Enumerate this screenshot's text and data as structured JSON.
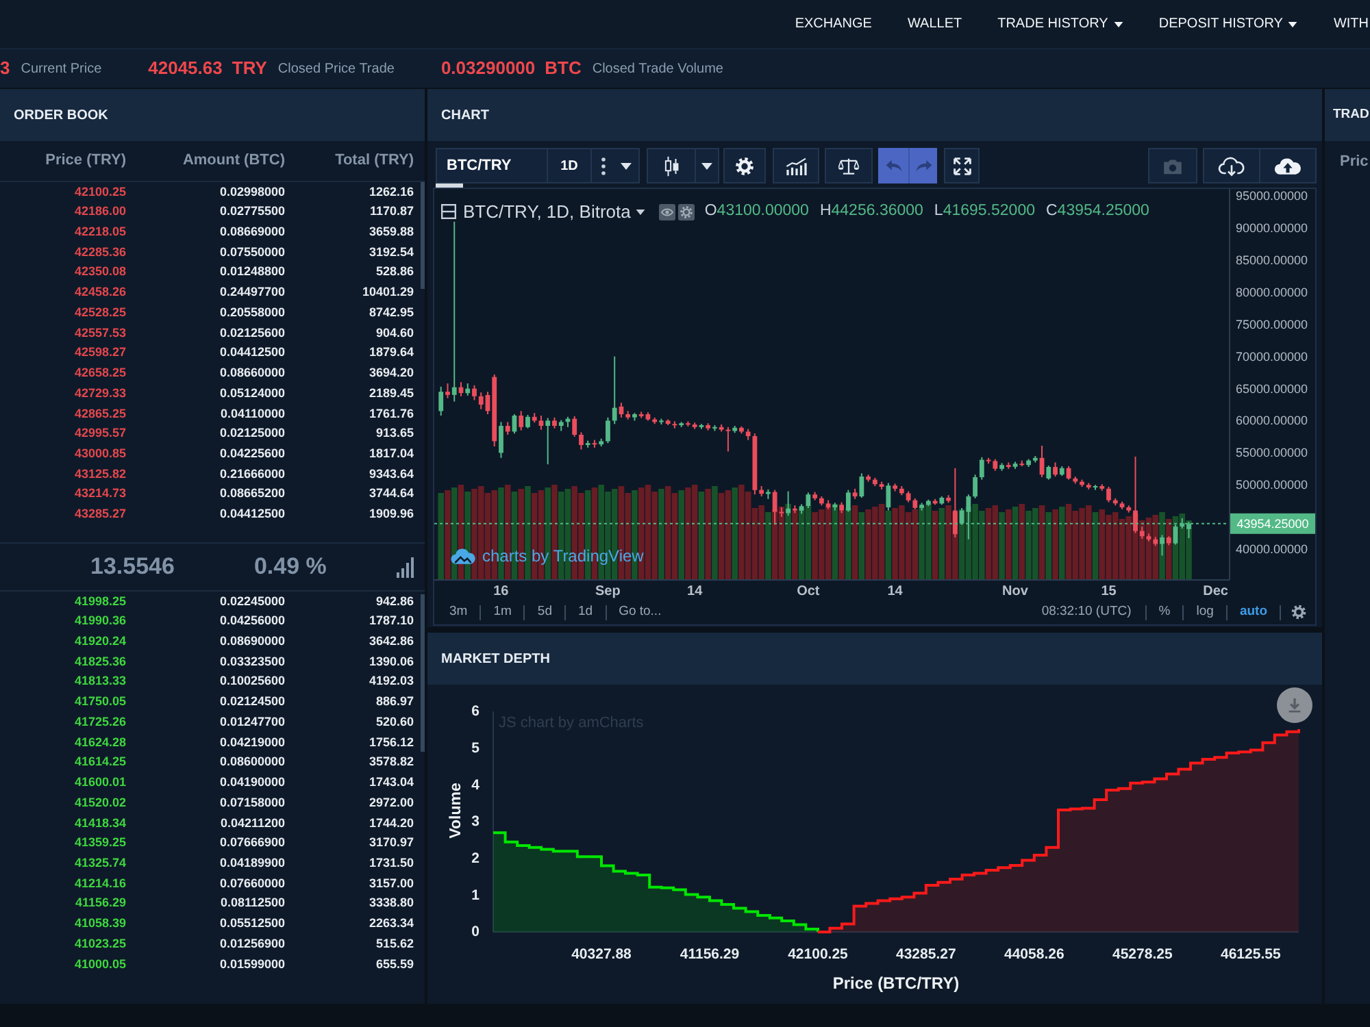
{
  "nav": {
    "items": [
      {
        "label": "EXCHANGE",
        "dropdown": false
      },
      {
        "label": "WALLET",
        "dropdown": false
      },
      {
        "label": "TRADE HISTORY",
        "dropdown": true
      },
      {
        "label": "DEPOSIT HISTORY",
        "dropdown": true
      },
      {
        "label": "WITH",
        "dropdown": false
      }
    ]
  },
  "ticker": [
    {
      "kind": "value",
      "text": "3"
    },
    {
      "kind": "label",
      "text": "Current Price"
    },
    {
      "kind": "value",
      "text": "42045.63"
    },
    {
      "kind": "unit",
      "text": "TRY"
    },
    {
      "kind": "label",
      "text": "Closed Price Trade"
    },
    {
      "kind": "value",
      "text": "0.03290000"
    },
    {
      "kind": "unit",
      "text": "BTC"
    },
    {
      "kind": "label",
      "text": "Closed Trade Volume"
    }
  ],
  "order_book": {
    "title": "ORDER BOOK",
    "columns": [
      "Price (TRY)",
      "Amount (BTC)",
      "Total (TRY)"
    ],
    "asks": [
      [
        "42100.25",
        "0.02998000",
        "1262.16"
      ],
      [
        "42186.00",
        "0.02775500",
        "1170.87"
      ],
      [
        "42218.05",
        "0.08669000",
        "3659.88"
      ],
      [
        "42285.36",
        "0.07550000",
        "3192.54"
      ],
      [
        "42350.08",
        "0.01248800",
        "528.86"
      ],
      [
        "42458.26",
        "0.24497700",
        "10401.29"
      ],
      [
        "42528.25",
        "0.20558000",
        "8742.95"
      ],
      [
        "42557.53",
        "0.02125600",
        "904.60"
      ],
      [
        "42598.27",
        "0.04412500",
        "1879.64"
      ],
      [
        "42658.25",
        "0.08660000",
        "3694.20"
      ],
      [
        "42729.33",
        "0.05124000",
        "2189.45"
      ],
      [
        "42865.25",
        "0.04110000",
        "1761.76"
      ],
      [
        "42995.57",
        "0.02125000",
        "913.65"
      ],
      [
        "43000.85",
        "0.04225600",
        "1817.04"
      ],
      [
        "43125.82",
        "0.21666000",
        "9343.64"
      ],
      [
        "43214.73",
        "0.08665200",
        "3744.64"
      ],
      [
        "43285.27",
        "0.04412500",
        "1909.96"
      ]
    ],
    "spread": {
      "value": "13.5546",
      "percent": "0.49 %"
    },
    "bids": [
      [
        "41998.25",
        "0.02245000",
        "942.86"
      ],
      [
        "41990.36",
        "0.04256000",
        "1787.10"
      ],
      [
        "41920.24",
        "0.08690000",
        "3642.86"
      ],
      [
        "41825.36",
        "0.03323500",
        "1390.06"
      ],
      [
        "41813.33",
        "0.10025600",
        "4192.03"
      ],
      [
        "41750.05",
        "0.02124500",
        "886.97"
      ],
      [
        "41725.26",
        "0.01247700",
        "520.60"
      ],
      [
        "41624.28",
        "0.04219000",
        "1756.12"
      ],
      [
        "41614.25",
        "0.08600000",
        "3578.82"
      ],
      [
        "41600.01",
        "0.04190000",
        "1743.04"
      ],
      [
        "41520.02",
        "0.07158000",
        "2972.00"
      ],
      [
        "41418.34",
        "0.04211200",
        "1744.20"
      ],
      [
        "41359.25",
        "0.07666900",
        "3170.97"
      ],
      [
        "41325.74",
        "0.04189900",
        "1731.50"
      ],
      [
        "41214.16",
        "0.07660000",
        "3157.00"
      ],
      [
        "41156.29",
        "0.08112500",
        "3338.80"
      ],
      [
        "41058.39",
        "0.05512500",
        "2263.34"
      ],
      [
        "41023.25",
        "0.01256900",
        "515.62"
      ],
      [
        "41000.05",
        "0.01599000",
        "655.59"
      ]
    ]
  },
  "chart": {
    "title": "CHART",
    "toolbar": {
      "symbol": "BTC/TRY",
      "interval": "1D"
    },
    "legend": {
      "title": "BTC/TRY, 1D, Bitrota",
      "values": [
        {
          "label": "O",
          "value": "43100.00000"
        },
        {
          "label": "H",
          "value": "44256.36000"
        },
        {
          "label": "L",
          "value": "41695.52000"
        },
        {
          "label": "C",
          "value": "43954.25000"
        }
      ]
    },
    "chart_data": {
      "type": "candlestick",
      "x": [
        "--08-07",
        "--08-08",
        "--08-09",
        "--08-10",
        "--08-11",
        "--08-12",
        "--08-13",
        "--08-14",
        "--08-15",
        "--08-16",
        "--08-17",
        "--08-18",
        "--08-19",
        "--08-20",
        "--08-21",
        "--08-22",
        "--08-23",
        "--08-24",
        "--08-25",
        "--08-26",
        "--08-27",
        "--08-28",
        "--08-29",
        "--08-30",
        "--08-31",
        "--09-01",
        "--09-02",
        "--09-03",
        "--09-04",
        "--09-05",
        "--09-06",
        "--09-07",
        "--09-08",
        "--09-09",
        "--09-10",
        "--09-11",
        "--09-12",
        "--09-13",
        "--09-14",
        "--09-15",
        "--09-16",
        "--09-17",
        "--09-18",
        "--09-19",
        "--09-20",
        "--09-21",
        "--09-22",
        "--09-23",
        "--09-24",
        "--09-25",
        "--09-26",
        "--09-27",
        "--09-28",
        "--09-29",
        "--09-30",
        "--10-01",
        "--10-02",
        "--10-03",
        "--10-04",
        "--10-05",
        "--10-06",
        "--10-07",
        "--10-08",
        "--10-09",
        "--10-10",
        "--10-11",
        "--10-12",
        "--10-13",
        "--10-14",
        "--10-15",
        "--10-16",
        "--10-17",
        "--10-18",
        "--10-19",
        "--10-20",
        "--10-21",
        "--10-22",
        "--10-23",
        "--10-24",
        "--10-25",
        "--10-26",
        "--10-27",
        "--10-28",
        "--10-29",
        "--10-30",
        "--10-31",
        "--11-01",
        "--11-02",
        "--11-03",
        "--11-04",
        "--11-05",
        "--11-06",
        "--11-07",
        "--11-08",
        "--11-09",
        "--11-10",
        "--11-11",
        "--11-12",
        "--11-13",
        "--11-14",
        "--11-15",
        "--11-16",
        "--11-17",
        "--11-18",
        "--11-19",
        "--11-20",
        "--11-21",
        "--11-22",
        "--11-23",
        "--11-24",
        "--11-25",
        "--11-26",
        "--11-27"
      ],
      "ohlc": [
        [
          61500,
          65300,
          60800,
          64500
        ],
        [
          64500,
          65800,
          63500,
          64000
        ],
        [
          64000,
          91000,
          63000,
          65200
        ],
        [
          65200,
          66000,
          63800,
          64300
        ],
        [
          64300,
          65800,
          63900,
          65000
        ],
        [
          65000,
          65500,
          63200,
          63800
        ],
        [
          63800,
          64400,
          61800,
          62500
        ],
        [
          64000,
          64500,
          61000,
          61500
        ],
        [
          66800,
          67200,
          56000,
          56800
        ],
        [
          55000,
          59800,
          54200,
          59200
        ],
        [
          59200,
          59800,
          57800,
          58300
        ],
        [
          58300,
          61000,
          58000,
          60800
        ],
        [
          60800,
          61500,
          58500,
          59000
        ],
        [
          59000,
          60900,
          58800,
          60600
        ],
        [
          60600,
          61200,
          59700,
          60000
        ],
        [
          60000,
          60800,
          58600,
          59200
        ],
        [
          59200,
          60400,
          53200,
          60000
        ],
        [
          60000,
          60500,
          58800,
          59200
        ],
        [
          59200,
          60100,
          58400,
          59800
        ],
        [
          59800,
          60600,
          59000,
          60300
        ],
        [
          60300,
          60700,
          57500,
          57800
        ],
        [
          57800,
          58200,
          55500,
          56200
        ],
        [
          56200,
          56900,
          55800,
          56500
        ],
        [
          56500,
          57000,
          55800,
          56300
        ],
        [
          56300,
          57200,
          56000,
          56800
        ],
        [
          56800,
          60500,
          56500,
          60000
        ],
        [
          60000,
          70000,
          59500,
          62000
        ],
        [
          62200,
          62800,
          60500,
          61000
        ],
        [
          61000,
          61500,
          60200,
          60500
        ],
        [
          60500,
          61200,
          60000,
          61000
        ],
        [
          61000,
          61400,
          60400,
          60700
        ],
        [
          61000,
          61300,
          60000,
          60200
        ],
        [
          60200,
          60500,
          59500,
          59800
        ],
        [
          59800,
          60300,
          59400,
          60000
        ],
        [
          60000,
          60200,
          59300,
          59500
        ],
        [
          59500,
          59900,
          58800,
          59300
        ],
        [
          59300,
          59800,
          59000,
          59600
        ],
        [
          59600,
          59900,
          59100,
          59400
        ],
        [
          59400,
          59700,
          58700,
          59000
        ],
        [
          59000,
          59500,
          58700,
          59300
        ],
        [
          59300,
          59600,
          58500,
          58800
        ],
        [
          58800,
          59300,
          58400,
          59000
        ],
        [
          59000,
          59400,
          58300,
          58600
        ],
        [
          58600,
          59000,
          55200,
          58400
        ],
        [
          58400,
          59200,
          58100,
          58900
        ],
        [
          58900,
          59100,
          58000,
          58300
        ],
        [
          58300,
          58700,
          57000,
          57600
        ],
        [
          57600,
          58000,
          48500,
          49200
        ],
        [
          49200,
          49800,
          48200,
          48600
        ],
        [
          48600,
          49300,
          47800,
          48900
        ],
        [
          48900,
          49200,
          43800,
          45800
        ],
        [
          45800,
          46500,
          45000,
          45600
        ],
        [
          45600,
          49000,
          45200,
          46300
        ],
        [
          46300,
          46800,
          45600,
          46000
        ],
        [
          46000,
          47000,
          45500,
          46700
        ],
        [
          46700,
          48800,
          46400,
          48500
        ],
        [
          48500,
          48900,
          47600,
          47900
        ],
        [
          47900,
          48200,
          46800,
          47100
        ],
        [
          47100,
          47600,
          46200,
          46500
        ],
        [
          46500,
          47200,
          46000,
          46900
        ],
        [
          46900,
          47300,
          45600,
          46000
        ],
        [
          46000,
          49200,
          45800,
          48800
        ],
        [
          48800,
          49400,
          47800,
          48200
        ],
        [
          48200,
          51800,
          48000,
          51300
        ],
        [
          51300,
          51600,
          50500,
          50800
        ],
        [
          50800,
          51100,
          49800,
          50100
        ],
        [
          50100,
          50500,
          49300,
          49700
        ],
        [
          46500,
          50300,
          46000,
          49900
        ],
        [
          49900,
          50200,
          49000,
          49400
        ],
        [
          49400,
          49800,
          48400,
          48700
        ],
        [
          48700,
          49000,
          47300,
          47600
        ],
        [
          47600,
          47900,
          46200,
          46400
        ],
        [
          46400,
          47200,
          46000,
          46900
        ],
        [
          46900,
          47700,
          46700,
          47500
        ],
        [
          47500,
          47800,
          46900,
          47100
        ],
        [
          47100,
          48200,
          46900,
          48000
        ],
        [
          48000,
          48400,
          47200,
          47500
        ],
        [
          46000,
          52600,
          41800,
          42300
        ],
        [
          44000,
          46400,
          43800,
          46000
        ],
        [
          45800,
          48500,
          41500,
          48200
        ],
        [
          48200,
          51600,
          47900,
          51200
        ],
        [
          51200,
          54300,
          50800,
          53900
        ],
        [
          53900,
          54200,
          53300,
          53700
        ],
        [
          53700,
          54000,
          52200,
          52500
        ],
        [
          52500,
          53400,
          52200,
          53100
        ],
        [
          53100,
          53500,
          52500,
          52800
        ],
        [
          52800,
          53600,
          52500,
          53300
        ],
        [
          53300,
          53800,
          52900,
          53100
        ],
        [
          53100,
          54000,
          52800,
          53800
        ],
        [
          53800,
          54500,
          53500,
          54200
        ],
        [
          54200,
          56100,
          51200,
          51600
        ],
        [
          51000,
          53000,
          50800,
          52800
        ],
        [
          52800,
          53500,
          51300,
          51600
        ],
        [
          51600,
          52900,
          51400,
          52600
        ],
        [
          52600,
          52900,
          50800,
          51000
        ],
        [
          51000,
          51300,
          50200,
          50500
        ],
        [
          50500,
          50800,
          49700,
          50000
        ],
        [
          50000,
          50300,
          49300,
          49600
        ],
        [
          49600,
          50000,
          49200,
          49800
        ],
        [
          49800,
          50100,
          49100,
          49400
        ],
        [
          49400,
          49700,
          47300,
          47600
        ],
        [
          47600,
          47900,
          46800,
          47100
        ],
        [
          47100,
          47400,
          46200,
          46500
        ],
        [
          46500,
          46800,
          45700,
          46000
        ],
        [
          46000,
          54400,
          42500,
          42800
        ],
        [
          42800,
          43500,
          41600,
          42000
        ],
        [
          42000,
          42400,
          41200,
          41500
        ],
        [
          41500,
          41900,
          40500,
          40800
        ],
        [
          40800,
          42200,
          39000,
          41800
        ],
        [
          41800,
          42000,
          40600,
          40900
        ],
        [
          40900,
          43800,
          40700,
          43500
        ],
        [
          43500,
          44800,
          43200,
          44000
        ],
        [
          43100,
          44256.36,
          41695.52,
          43954.25
        ]
      ],
      "xlim": [
        "--08-06",
        "--12-03"
      ],
      "ylim": [
        35300,
        96100
      ],
      "xticks": [
        {
          "value": "--08-16",
          "label": "16"
        },
        {
          "value": "--09-01",
          "label": "Sep"
        },
        {
          "value": "--09-14",
          "label": "14"
        },
        {
          "value": "--10-01",
          "label": "Oct"
        },
        {
          "value": "--10-14",
          "label": "14"
        },
        {
          "value": "--11-01",
          "label": "Nov"
        },
        {
          "value": "--11-15",
          "label": "15"
        },
        {
          "value": "--12-01",
          "label": "Dec"
        }
      ],
      "yticks": [
        {
          "value": 40000,
          "label": "40000.00000"
        },
        {
          "value": 50000,
          "label": "50000.00000"
        },
        {
          "value": 55000,
          "label": "55000.00000"
        },
        {
          "value": 60000,
          "label": "60000.00000"
        },
        {
          "value": 65000,
          "label": "65000.00000"
        },
        {
          "value": 70000,
          "label": "70000.00000"
        },
        {
          "value": 75000,
          "label": "75000.00000"
        },
        {
          "value": 80000,
          "label": "80000.00000"
        },
        {
          "value": 85000,
          "label": "85000.00000"
        },
        {
          "value": 90000,
          "label": "90000.00000"
        },
        {
          "value": 95000,
          "label": "95000.00000"
        }
      ],
      "ref_lines": [
        {
          "axis": "y",
          "value": 43954.25,
          "label": "43954.25000",
          "color": "#53b987",
          "line_style": "dashed"
        }
      ],
      "annotations": [
        "charts by TradingView"
      ]
    },
    "bottom_bar": {
      "time_ranges": [
        "3m",
        "1m",
        "5d",
        "1d"
      ],
      "goto": "Go to...",
      "clock": "08:32:10 (UTC)",
      "scale_options": [
        {
          "label": "%",
          "on": false
        },
        {
          "label": "log",
          "on": false
        },
        {
          "label": "auto",
          "on": true
        }
      ]
    }
  },
  "market_depth": {
    "title": "MARKET DEPTH",
    "chart_data": {
      "type": "step",
      "xlabel": "Price (BTC/TRY)",
      "ylabel": "Volume",
      "categories": [
        null,
        null,
        null,
        null,
        null,
        null,
        null,
        null,
        null,
        "40327.88",
        null,
        null,
        null,
        null,
        null,
        null,
        null,
        null,
        "41156.29",
        null,
        null,
        null,
        null,
        null,
        null,
        null,
        null,
        "42100.25",
        null,
        null,
        null,
        null,
        null,
        null,
        null,
        null,
        "43285.27",
        null,
        null,
        null,
        null,
        null,
        null,
        null,
        null,
        "44058.26",
        null,
        null,
        null,
        null,
        null,
        null,
        null,
        null,
        "45278.25",
        null,
        null,
        null,
        null,
        null,
        null,
        null,
        null,
        "46125.55",
        null,
        null,
        null,
        null
      ],
      "series": [
        {
          "color": "#00e600",
          "values": [
            2.7,
            2.45,
            2.35,
            2.3,
            2.25,
            2.2,
            2.2,
            2.05,
            2.05,
            1.8,
            1.65,
            1.6,
            1.55,
            1.22,
            1.2,
            1.15,
            1.02,
            0.95,
            0.85,
            0.75,
            0.65,
            0.55,
            0.45,
            0.38,
            0.3,
            0.2,
            0.08,
            0,
            null,
            null,
            null,
            null,
            null,
            null,
            null,
            null,
            null,
            null,
            null,
            null,
            null,
            null,
            null,
            null,
            null,
            null,
            null,
            null,
            null,
            null,
            null,
            null,
            null,
            null,
            null,
            null,
            null,
            null,
            null,
            null,
            null,
            null,
            null,
            null,
            null,
            null,
            null,
            null
          ]
        },
        {
          "color": "#ff1a1a",
          "values": [
            null,
            null,
            null,
            null,
            null,
            null,
            null,
            null,
            null,
            null,
            null,
            null,
            null,
            null,
            null,
            null,
            null,
            null,
            null,
            null,
            null,
            null,
            null,
            null,
            null,
            null,
            null,
            0,
            0.1,
            0.22,
            0.7,
            0.78,
            0.85,
            0.9,
            0.95,
            1.06,
            1.27,
            1.35,
            1.44,
            1.55,
            1.6,
            1.68,
            1.75,
            1.81,
            1.95,
            2.09,
            2.3,
            3.32,
            3.35,
            3.37,
            3.6,
            3.86,
            3.9,
            4.05,
            4.08,
            4.17,
            4.3,
            4.43,
            4.6,
            4.7,
            4.75,
            4.87,
            4.9,
            4.95,
            5.15,
            5.36,
            5.45,
            5.52
          ]
        }
      ],
      "ylim": [
        0,
        6
      ],
      "yticks": [
        {
          "value": 0,
          "label": "0"
        },
        {
          "value": 1,
          "label": "1"
        },
        {
          "value": 2,
          "label": "2"
        },
        {
          "value": 3,
          "label": "3"
        },
        {
          "value": 4,
          "label": "4"
        },
        {
          "value": 5,
          "label": "5"
        },
        {
          "value": 6,
          "label": "6"
        }
      ],
      "annotations": [
        "JS chart by amCharts"
      ]
    }
  },
  "trade_panel": {
    "title": "TRAD",
    "column_1": "Pric"
  }
}
